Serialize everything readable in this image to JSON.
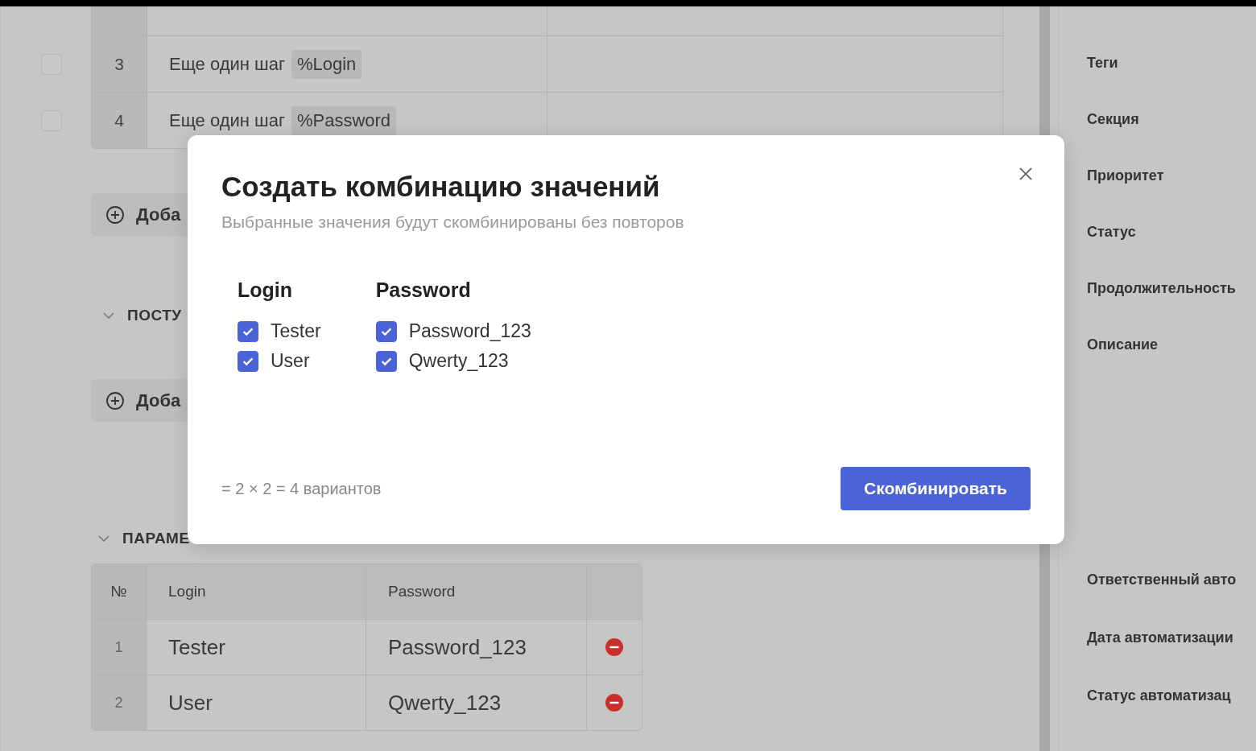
{
  "steps": [
    {
      "number": "3",
      "text": "Еще один шаг",
      "param": "%Login",
      "checked": false
    },
    {
      "number": "4",
      "text": "Еще один шаг",
      "param": "%Password",
      "checked": false
    }
  ],
  "add_step_button": {
    "label": "Доба"
  },
  "postconditions": {
    "title": "ПОСТУ",
    "expanded": true,
    "add_button": "Доба"
  },
  "parameters": {
    "title": "ПАРАМЕ",
    "expanded": true,
    "columns": [
      "№",
      "Login",
      "Password"
    ],
    "rows": [
      {
        "number": "1",
        "values": [
          "Tester",
          "Password_123"
        ]
      },
      {
        "number": "2",
        "values": [
          "User",
          "Qwerty_123"
        ]
      }
    ]
  },
  "sidebar": {
    "fields": [
      "Теги",
      "Секция",
      "Приоритет",
      "Статус",
      "Продолжительность",
      "Описание"
    ],
    "fields_bottom": [
      "Ответственный авто",
      "Дата автоматизации",
      "Статус автоматизац"
    ]
  },
  "dialog": {
    "title": "Создать комбинацию значений",
    "subtitle": "Выбранные значения будут скомбинированы без повторов",
    "groups": [
      {
        "title": "Login",
        "options": [
          {
            "label": "Tester",
            "checked": true
          },
          {
            "label": "User",
            "checked": true
          }
        ]
      },
      {
        "title": "Password",
        "options": [
          {
            "label": "Password_123",
            "checked": true
          },
          {
            "label": "Qwerty_123",
            "checked": true
          }
        ]
      }
    ],
    "formula": "= 2 × 2 = 4 вариантов",
    "submit": "Скомбинировать"
  }
}
